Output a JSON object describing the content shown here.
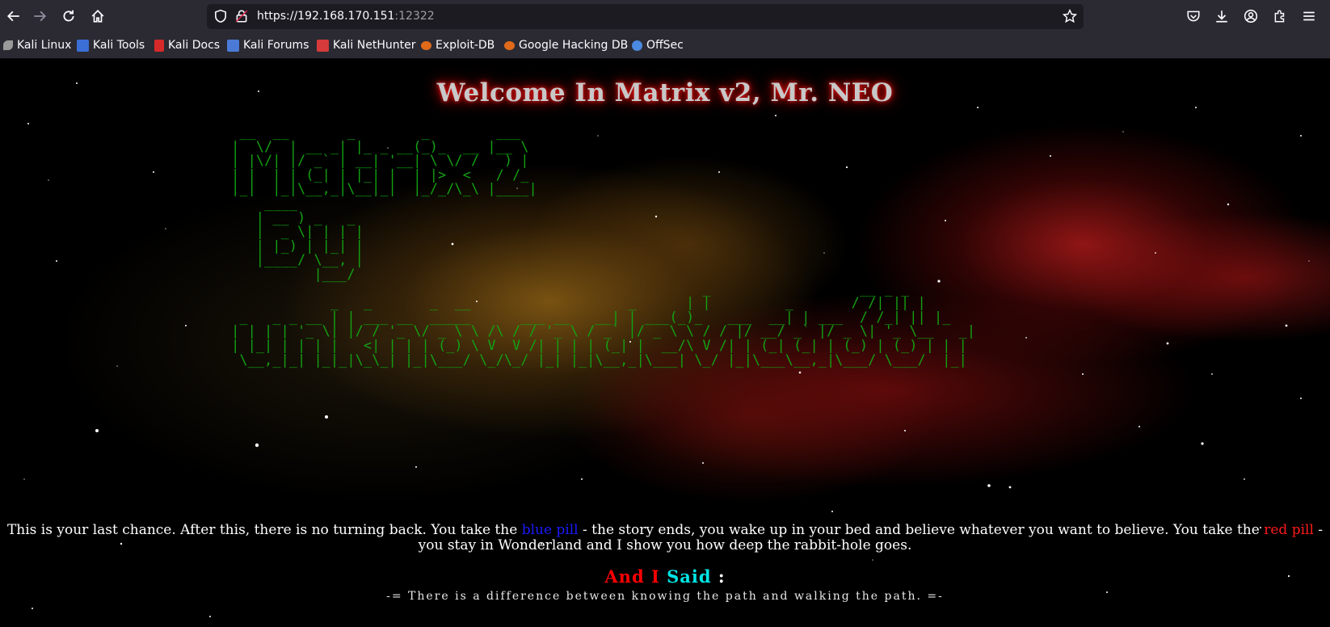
{
  "browser": {
    "url_host": "https://192.168.170.151",
    "url_port": ":12322",
    "bookmarks": [
      {
        "label": "Kali Linux",
        "color": "#9a9a9a"
      },
      {
        "label": "Kali Tools",
        "color": "#3b6fd6"
      },
      {
        "label": "Kali Docs",
        "color": "#d62a2a"
      },
      {
        "label": "Kali Forums",
        "color": "#4a7ad6"
      },
      {
        "label": "Kali NetHunter",
        "color": "#d63a3a"
      },
      {
        "label": "Exploit-DB",
        "color": "#e06a1a"
      },
      {
        "label": "Google Hacking DB",
        "color": "#e06a1a"
      },
      {
        "label": "OffSec",
        "color": "#4a8ae0"
      }
    ]
  },
  "page": {
    "headline": "Welcome In Matrix v2, Mr. NEO",
    "ascii_art": "  __  __       _        _        ___\n |  \\/  | __ _| |_ _ __(_)_  __ |__ \\\n | |\\/| |/ _` | __| '__| \\ \\/ /   ) |\n | |  | | (_| | |_| |  | |>  <   / /_\n |_|  |_|\\__,_|\\__|_|  |_/_/\\_\\ |____|\n     ____\n    | __ ) _   _\n    |  _ \\| | | |\n    | |_) | |_| |\n    |____/ \\__, |\n           |___/\n                                                          _                  __ _ _\n             _   _       _  __                   _      | |         _       / /| || |\n  _   _ _ __ | | ___ __  _____      ___ __   __| | ___(_)_   ___  __| | ___  / /_| || |_\n | | | | '_ \\| |/ / '_ \\/ _ \\ \\ /\\ / / '_ \\ / _` |/ _ \\ \\ / / |/ __/ _` |/ _ \\| '_ \\__   _|\n | |_| | | | |   <| | | | (_) \\ V  V /| | | | (_| |  __/\\ V /| | (_| (_| | (_) | (_) | | |\n  \\__,_|_| |_|_|\\_\\_| |_|\\___/ \\_/\\_/ |_| |_|\\__,_|\\___| \\_/ |_|\\___\\__,_|\\___/ \\___/  |_|",
    "quote": {
      "part1": "This is your last chance. After this, there is no turning back. You take the ",
      "blue": "blue pill",
      "part2": " - the story ends, you wake up in your bed and believe whatever you want to believe. You take the ",
      "red": "red pill",
      "part3": " - you stay in Wonderland and I show you how deep the rabbit-hole goes."
    },
    "said": {
      "and_i": "And I",
      "said": "Said",
      "colon": ":"
    },
    "motto": "-= There is a difference between knowing the path and walking the path. =-"
  }
}
